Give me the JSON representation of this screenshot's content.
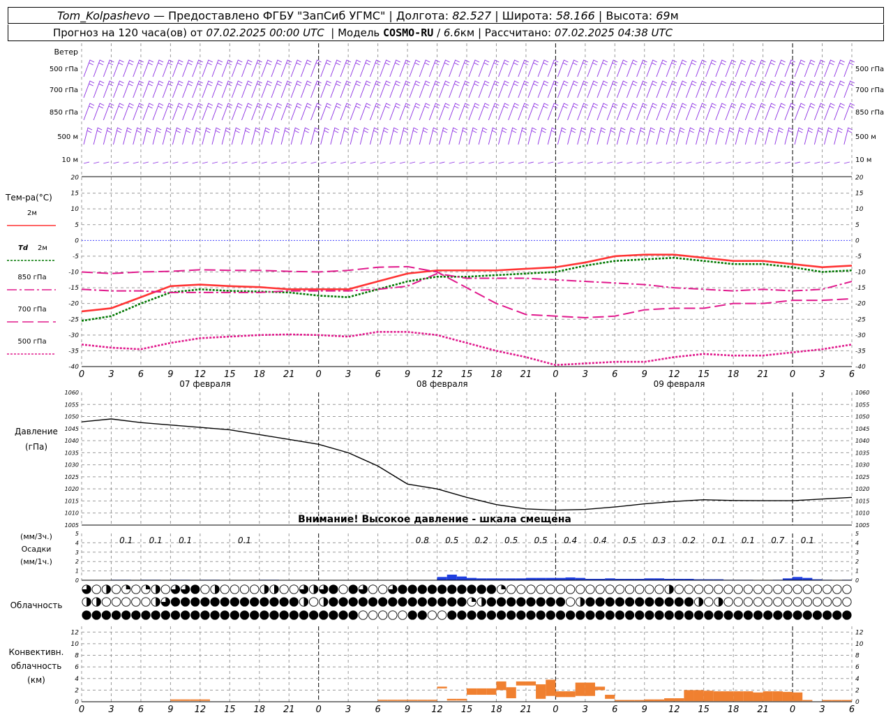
{
  "header": {
    "station": "Tom_Kolpashevo",
    "dash": "—",
    "provider": "Предоставлено ФГБУ \"ЗапСиб УГМС\"",
    "lon_label": "Долгота:",
    "lon": "82.527",
    "lat_label": "Широта:",
    "lat": "58.166",
    "alt_label": "Высота:",
    "alt": "69",
    "alt_unit": "м",
    "forecast_label": "Прогноз на 120 часа(ов) от",
    "forecast_start": "07.02.2025 00:00 UTC",
    "model_label": "Модель",
    "model": "COSMO-RU",
    "model_res": "6.6",
    "res_unit": "км",
    "calc_label": "Рассчитано:",
    "calc_time": "07.02.2025 04:38 UTC",
    "sep": "|"
  },
  "colors": {
    "t2m": "#ff3333",
    "td2m": "#007700",
    "t850": "#e0188c",
    "t700": "#e0188c",
    "t500": "#e0188c",
    "zero_line": "#4444ff",
    "precip": "#1f3fe0",
    "convective": "#f08030",
    "wind_barb": "#8a2be2",
    "pressure": "#000000",
    "grid": "#999999"
  },
  "chart_data": [
    {
      "type": "wind_barbs",
      "panel_label": "Ветер",
      "levels": [
        "500 гПа",
        "700 гПа",
        "850 гПа",
        "500 м",
        "10  м"
      ],
      "x_unit": "hours since 07.02.2025 00:00 UTC",
      "x": [
        0,
        3,
        6,
        9,
        12,
        15,
        18,
        21,
        24,
        27,
        30,
        33,
        36,
        39,
        42,
        45,
        48,
        51,
        54,
        57,
        60,
        63,
        66,
        69,
        72
      ]
    },
    {
      "type": "line",
      "panel_label": "Тем-ра(°C)",
      "y_ticks": [
        20,
        15,
        10,
        5,
        0,
        -5,
        -10,
        -15,
        -20,
        -25,
        -30,
        -35,
        -40
      ],
      "ylim": [
        -40,
        20
      ],
      "x_ticks": [
        "0",
        "3",
        "6",
        "9",
        "12",
        "15",
        "18",
        "21",
        "0",
        "3",
        "6",
        "9",
        "12",
        "15",
        "18",
        "21",
        "0",
        "3",
        "6",
        "9",
        "12",
        "15",
        "18",
        "21",
        "0",
        "3",
        "6"
      ],
      "day_labels": [
        "07 февраля",
        "08 февраля",
        "09 февраля"
      ],
      "x": [
        0,
        3,
        6,
        9,
        12,
        15,
        18,
        21,
        24,
        27,
        30,
        33,
        36,
        39,
        42,
        45,
        48,
        51,
        54,
        57,
        60,
        63,
        66,
        69,
        72,
        75,
        78
      ],
      "series": [
        {
          "name": "2м",
          "values": [
            -22.5,
            -21.5,
            -18,
            -14.5,
            -14,
            -14.5,
            -14.8,
            -15.5,
            -15.5,
            -15.5,
            -13,
            -10.5,
            -9.5,
            -9.5,
            -9.5,
            -9,
            -8.5,
            -7,
            -5,
            -4.5,
            -4.5,
            -5.5,
            -6.5,
            -6.5,
            -7.5,
            -8.5,
            -8
          ]
        },
        {
          "name": "Td 2м",
          "values": [
            -25.5,
            -24,
            -20,
            -16.5,
            -15.5,
            -16,
            -16.2,
            -16.5,
            -17.5,
            -18,
            -15.5,
            -13,
            -11.5,
            -11.5,
            -11,
            -10.5,
            -10,
            -8,
            -6.5,
            -6,
            -5.5,
            -6.5,
            -7.5,
            -7.5,
            -8.5,
            -10,
            -9.5
          ]
        },
        {
          "name": "850 гПа",
          "values": [
            -15.5,
            -16,
            -16,
            -16.5,
            -16.5,
            -16.5,
            -16.5,
            -16,
            -16,
            -16,
            -15.5,
            -14.5,
            -10.5,
            -12,
            -12,
            -12,
            -12.5,
            -13,
            -13.5,
            -14,
            -15,
            -15.5,
            -16,
            -15.5,
            -16,
            -15.5,
            -13
          ]
        },
        {
          "name": "700 гПа",
          "values": [
            -10,
            -10.5,
            -10,
            -9.8,
            -9.3,
            -9.5,
            -9.5,
            -9.8,
            -10,
            -9.5,
            -8.5,
            -8.3,
            -10,
            -15,
            -20,
            -23.5,
            -24,
            -24.5,
            -24,
            -22,
            -21.5,
            -21.5,
            -20,
            -20,
            -19,
            -19,
            -18.5
          ]
        },
        {
          "name": "500 гПа",
          "values": [
            -33,
            -34,
            -34.5,
            -32.5,
            -31,
            -30.5,
            -30,
            -29.8,
            -30,
            -30.5,
            -29,
            -29,
            -30,
            -32.5,
            -35,
            -37,
            -39.5,
            -39,
            -38.5,
            -38.5,
            -37,
            -36,
            -36.5,
            -36.5,
            -35.5,
            -34.5,
            -33
          ]
        }
      ],
      "legend": [
        "2м",
        "Td 2м",
        "850 гПа",
        "700 гПа",
        "500 гПа"
      ],
      "legend_prefix": "Td"
    },
    {
      "type": "line",
      "panel_label": "Давление",
      "panel_unit": "(гПа)",
      "ylim": [
        1005,
        1060
      ],
      "y_ticks": [
        1060,
        1055,
        1050,
        1045,
        1040,
        1035,
        1030,
        1025,
        1020,
        1015,
        1010,
        1005
      ],
      "x": [
        0,
        3,
        6,
        9,
        12,
        15,
        18,
        21,
        24,
        27,
        30,
        33,
        36,
        39,
        42,
        45,
        48,
        51,
        54,
        57,
        60,
        63,
        66,
        69,
        72,
        75,
        78
      ],
      "series": [
        {
          "values": [
            1047.8,
            1049,
            1047.5,
            1046.5,
            1045.5,
            1044.5,
            1042.5,
            1040.5,
            1038.5,
            1035,
            1029.5,
            1022,
            1020,
            1016.5,
            1013.5,
            1011.7,
            1011.2,
            1011.5,
            1012.5,
            1013.8,
            1014.8,
            1015.5,
            1015.2,
            1015.1,
            1015.1,
            1015.8,
            1016.5
          ]
        }
      ],
      "annotation": "Внимание! Высокое давление - шкала смещена"
    },
    {
      "type": "bar",
      "panel_label": "Осадки",
      "unit_3h": "(мм/3ч.)",
      "unit_1h": "(мм/1ч.)",
      "ylim": [
        0,
        5
      ],
      "y_ticks": [
        5,
        4,
        3,
        2,
        1,
        0
      ],
      "x": [
        0,
        1,
        2,
        3,
        4,
        5,
        6,
        7,
        8,
        9,
        10,
        11,
        12,
        13,
        14,
        15,
        16,
        17,
        18,
        19,
        20,
        21,
        22,
        23,
        24,
        25,
        26,
        27,
        28,
        29,
        30,
        31,
        32,
        33,
        34,
        35,
        36,
        37,
        38,
        39,
        40,
        41,
        42,
        43,
        44,
        45,
        46,
        47,
        48,
        49,
        50,
        51,
        52,
        53,
        54,
        55,
        56,
        57,
        58,
        59,
        60,
        61,
        62,
        63,
        64,
        65,
        66,
        67,
        68,
        69,
        70,
        71,
        72,
        73,
        74,
        75,
        76,
        77
      ],
      "values_1h": [
        0,
        0,
        0,
        0.05,
        0.05,
        0,
        0.05,
        0.05,
        0,
        0.05,
        0.05,
        0,
        0.05,
        0.05,
        0,
        0,
        0,
        0,
        0.05,
        0.05,
        0,
        0,
        0,
        0,
        0,
        0,
        0,
        0,
        0,
        0,
        0,
        0,
        0,
        0,
        0,
        0,
        0.35,
        0.6,
        0.4,
        0.25,
        0.2,
        0.2,
        0.2,
        0.2,
        0.2,
        0.25,
        0.25,
        0.25,
        0.25,
        0.3,
        0.25,
        0.15,
        0.15,
        0.2,
        0.15,
        0.15,
        0.15,
        0.2,
        0.2,
        0.15,
        0.15,
        0.15,
        0.1,
        0.1,
        0.1,
        0.05,
        0.05,
        0.05,
        0,
        0,
        0.05,
        0.2,
        0.35,
        0.25,
        0.1,
        0.05,
        0,
        0.05
      ],
      "totals_3h": [
        {
          "x_hour": 4.5,
          "value": "0.1"
        },
        {
          "x_hour": 7.5,
          "value": "0.1"
        },
        {
          "x_hour": 10.5,
          "value": "0.1"
        },
        {
          "x_hour": 16.5,
          "value": "0.1"
        },
        {
          "x_hour": 34.5,
          "value": "0.8"
        },
        {
          "x_hour": 37.5,
          "value": "0.5"
        },
        {
          "x_hour": 40.5,
          "value": "0.2"
        },
        {
          "x_hour": 43.5,
          "value": "0.5"
        },
        {
          "x_hour": 46.5,
          "value": "0.5"
        },
        {
          "x_hour": 49.5,
          "value": "0.4"
        },
        {
          "x_hour": 52.5,
          "value": "0.4"
        },
        {
          "x_hour": 55.5,
          "value": "0.5"
        },
        {
          "x_hour": 58.5,
          "value": "0.3"
        },
        {
          "x_hour": 61.5,
          "value": "0.2"
        },
        {
          "x_hour": 64.5,
          "value": "0.1"
        },
        {
          "x_hour": 67.5,
          "value": "0.1"
        },
        {
          "x_hour": 70.5,
          "value": "0.7"
        },
        {
          "x_hour": 73.5,
          "value": "0.1"
        }
      ]
    },
    {
      "type": "cloud_symbols",
      "panel_label": "Облачность",
      "rows": [
        "upper",
        "middle",
        "lower"
      ],
      "fraction_codes": "0 = clear, 1 = 1/4, 2 = half, 3 = 3/4, 4 = overcast, one symbol per hour",
      "upper": "3020101203340200002200323404300344444444441000000000000000020000000000000000000",
      "middle": "2200000234444444444444202444444444444441244444444024444444444420200000000000000",
      "lower": "4444444444444444444444444444000004400444444444444444444444444444444444444444444"
    },
    {
      "type": "bar",
      "panel_label": "Конвективн. облачность (км)",
      "ylim": [
        0,
        13
      ],
      "y_ticks": [
        12,
        10,
        8,
        6,
        4,
        2,
        0
      ],
      "layers_km": [
        {
          "h": 9,
          "base": 0.15,
          "top": 0.4
        },
        {
          "h": 10,
          "base": 0.15,
          "top": 0.4
        },
        {
          "h": 11,
          "base": 0.15,
          "top": 0.4
        },
        {
          "h": 12,
          "base": 0.15,
          "top": 0.4
        },
        {
          "h": 30,
          "base": 0.15,
          "top": 0.35
        },
        {
          "h": 31,
          "base": 0.15,
          "top": 0.35
        },
        {
          "h": 32,
          "base": 0.15,
          "top": 0.35
        },
        {
          "h": 33,
          "base": 0.15,
          "top": 0.35
        },
        {
          "h": 34,
          "base": 0.15,
          "top": 0.35
        },
        {
          "h": 35,
          "base": 0.15,
          "top": 0.35
        },
        {
          "h": 36,
          "base": 2.3,
          "top": 2.6
        },
        {
          "h": 37,
          "base": 0.2,
          "top": 0.5
        },
        {
          "h": 38,
          "base": 0.2,
          "top": 0.5
        },
        {
          "h": 39,
          "base": 1.2,
          "top": 2.3
        },
        {
          "h": 40,
          "base": 1.2,
          "top": 2.3
        },
        {
          "h": 41,
          "base": 1.2,
          "top": 2.3
        },
        {
          "h": 42,
          "base": 2.0,
          "top": 3.5
        },
        {
          "h": 43,
          "base": 0.6,
          "top": 2.5
        },
        {
          "h": 44,
          "base": 2.8,
          "top": 3.5
        },
        {
          "h": 45,
          "base": 2.8,
          "top": 3.5
        },
        {
          "h": 46,
          "base": 0.5,
          "top": 3.0
        },
        {
          "h": 47,
          "base": 1.0,
          "top": 3.8
        },
        {
          "h": 48,
          "base": 0.8,
          "top": 1.8
        },
        {
          "h": 49,
          "base": 0.8,
          "top": 1.8
        },
        {
          "h": 50,
          "base": 1.0,
          "top": 3.3
        },
        {
          "h": 51,
          "base": 1.0,
          "top": 3.3
        },
        {
          "h": 52,
          "base": 2.0,
          "top": 2.6
        },
        {
          "h": 53,
          "base": 0.5,
          "top": 1.2
        },
        {
          "h": 54,
          "base": 0.1,
          "top": 0.3
        },
        {
          "h": 55,
          "base": 0.1,
          "top": 0.3
        },
        {
          "h": 56,
          "base": 0.1,
          "top": 0.3
        },
        {
          "h": 57,
          "base": 0.1,
          "top": 0.4
        },
        {
          "h": 58,
          "base": 0.1,
          "top": 0.4
        },
        {
          "h": 59,
          "base": 0.1,
          "top": 0.6
        },
        {
          "h": 60,
          "base": 0.1,
          "top": 0.6
        },
        {
          "h": 61,
          "base": 0.1,
          "top": 2.0
        },
        {
          "h": 62,
          "base": 0.1,
          "top": 2.0
        },
        {
          "h": 63,
          "base": 0.1,
          "top": 1.9
        },
        {
          "h": 64,
          "base": 0.1,
          "top": 1.8
        },
        {
          "h": 65,
          "base": 0.1,
          "top": 1.8
        },
        {
          "h": 66,
          "base": 0.1,
          "top": 1.8
        },
        {
          "h": 67,
          "base": 0.1,
          "top": 1.8
        },
        {
          "h": 68,
          "base": 0.1,
          "top": 1.6
        },
        {
          "h": 69,
          "base": 0.1,
          "top": 1.8
        },
        {
          "h": 70,
          "base": 0.1,
          "top": 1.8
        },
        {
          "h": 71,
          "base": 0.1,
          "top": 1.7
        },
        {
          "h": 72,
          "base": 0.1,
          "top": 1.6
        },
        {
          "h": 73,
          "base": 0.1,
          "top": 0.3
        },
        {
          "h": 75,
          "base": 0.1,
          "top": 0.3
        },
        {
          "h": 76,
          "base": 0.1,
          "top": 0.3
        },
        {
          "h": 77,
          "base": 0.1,
          "top": 0.3
        }
      ]
    }
  ]
}
